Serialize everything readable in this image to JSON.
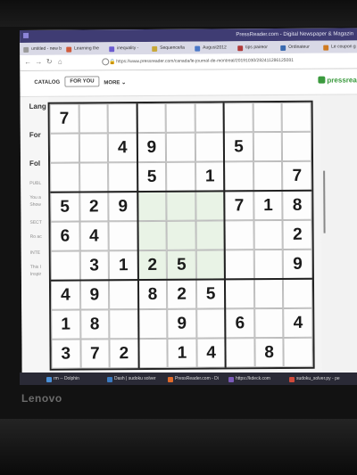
{
  "browser": {
    "window_title": "PressReader.com - Digital Newspaper & Magazin",
    "tabs": [
      {
        "label": "untitled - new b",
        "color": "#9a9a9a"
      },
      {
        "label": "Learning the",
        "color": "#d05a3a"
      },
      {
        "label": "inequality -",
        "color": "#6b5bd0"
      },
      {
        "label": "Sequence/la",
        "color": "#c8a838"
      },
      {
        "label": "August2012",
        "color": "#4a78c8"
      },
      {
        "label": "tips paireor",
        "color": "#b03a3a"
      },
      {
        "label": "Ordinateur",
        "color": "#3a6ab0"
      },
      {
        "label": "Le coupon g",
        "color": "#d07a20"
      }
    ],
    "url": "https://www.pressreader.com/canada/le-journal-de-montreal/20191030/282411286125081"
  },
  "site": {
    "nav": {
      "catalog": "CATALOG",
      "for_you": "FOR YOU",
      "more": "MORE"
    },
    "brand": "pressrea",
    "left_column": [
      "Lang",
      "For",
      "Fol",
      "PUBL",
      "You a",
      "Show",
      "SECT",
      "Ro ac",
      "INTE",
      "This l",
      "Inspir"
    ]
  },
  "sudoku": {
    "rows": [
      [
        "7",
        "",
        "",
        "",
        "",
        "",
        "",
        "",
        ""
      ],
      [
        "",
        "",
        "4",
        "9",
        "",
        "",
        "5",
        "",
        ""
      ],
      [
        "",
        "",
        "",
        "5",
        "",
        "1",
        "",
        "",
        "7"
      ],
      [
        "5",
        "2",
        "9",
        "",
        "",
        "",
        "7",
        "1",
        "8"
      ],
      [
        "6",
        "4",
        "",
        "",
        "",
        "",
        "",
        "",
        "2"
      ],
      [
        "",
        "3",
        "1",
        "2",
        "5",
        "",
        "",
        "",
        "9"
      ],
      [
        "4",
        "9",
        "",
        "8",
        "2",
        "5",
        "",
        "",
        ""
      ],
      [
        "1",
        "8",
        "",
        "",
        "9",
        "",
        "6",
        "",
        "4"
      ],
      [
        "3",
        "7",
        "2",
        "",
        "1",
        "4",
        "",
        "8",
        ""
      ]
    ]
  },
  "taskbar": [
    {
      "label": "rm -- Dolphin",
      "color": "#4a90d8"
    },
    {
      "label": "Dash | sudoku solver",
      "color": "#3a7ac0"
    },
    {
      "label": "PressReader.com - Di",
      "color": "#e06a2a"
    },
    {
      "label": "https://kdeck.com",
      "color": "#7a5ab8"
    },
    {
      "label": "sudoku_solver.py - pe",
      "color": "#d04a3a"
    }
  ],
  "laptop_brand": "Lenovo"
}
